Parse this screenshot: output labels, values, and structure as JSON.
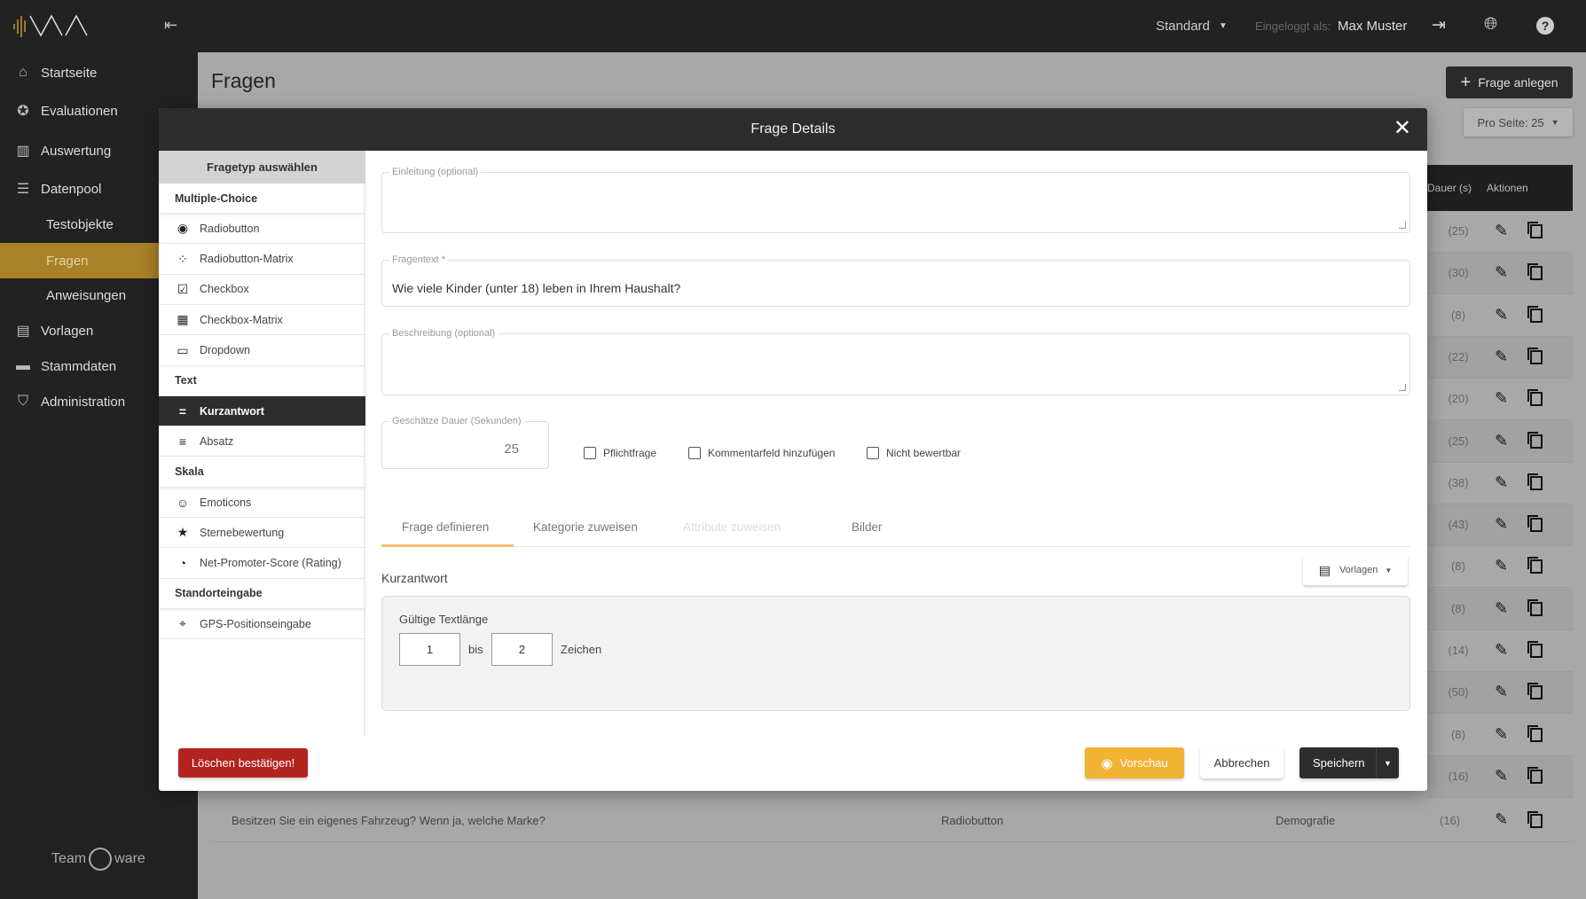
{
  "topbar": {
    "mode_label": "Standard",
    "logged_in_label": "Eingeloggt als:",
    "user_name": "Max Muster",
    "icons": [
      "logout-icon",
      "globe-icon",
      "help-icon"
    ]
  },
  "sidebar": {
    "items": [
      {
        "label": "Startseite",
        "icon": "home-icon"
      },
      {
        "label": "Evaluationen",
        "icon": "star-circle-icon"
      },
      {
        "label": "Auswertung",
        "icon": "bar-chart-icon"
      },
      {
        "label": "Datenpool",
        "icon": "list-icon"
      },
      {
        "label": "Testobjekte",
        "sub": true
      },
      {
        "label": "Fragen",
        "sub": true,
        "active": true
      },
      {
        "label": "Anweisungen",
        "sub": true
      },
      {
        "label": "Vorlagen",
        "icon": "template-icon"
      },
      {
        "label": "Stammdaten",
        "icon": "tray-icon"
      },
      {
        "label": "Administration",
        "icon": "shield-icon"
      }
    ],
    "footer_logo": "Team ware"
  },
  "page": {
    "title": "Fragen",
    "create_button": "Frage anlegen",
    "per_page": "Pro Seite: 25",
    "table": {
      "headers": [
        "Dauer (s)",
        "Aktionen"
      ],
      "durations": [
        "(25)",
        "(30)",
        "(8)",
        "(22)",
        "(20)",
        "(25)",
        "(38)",
        "(43)",
        "(8)",
        "(8)",
        "(14)",
        "(50)",
        "(8)",
        "(16)"
      ],
      "last_row": {
        "question": "Besitzen Sie ein eigenes Fahrzeug? Wenn ja, welche Marke?",
        "type": "Radiobutton",
        "category": "Demografie",
        "duration": "(16)"
      }
    }
  },
  "modal": {
    "title": "Frage Details",
    "type_panel": {
      "header": "Fragetyp auswählen",
      "rows": [
        {
          "label": "Multiple-Choice",
          "category": true
        },
        {
          "label": "Radiobutton",
          "icon": "◉"
        },
        {
          "label": "Radiobutton-Matrix",
          "icon": "⁘"
        },
        {
          "label": "Checkbox",
          "icon": "☑"
        },
        {
          "label": "Checkbox-Matrix",
          "icon": "▦"
        },
        {
          "label": "Dropdown",
          "icon": "▭"
        },
        {
          "label": "Text",
          "category": true
        },
        {
          "label": "Kurzantwort",
          "icon": "=",
          "selected": true
        },
        {
          "label": "Absatz",
          "icon": "≡"
        },
        {
          "label": "Skala",
          "category": true
        },
        {
          "label": "Emoticons",
          "icon": "☺"
        },
        {
          "label": "Sternebewertung",
          "icon": "★"
        },
        {
          "label": "Net-Promoter-Score (Rating)",
          "icon": "◔"
        },
        {
          "label": "Standorteingabe",
          "category": true
        },
        {
          "label": "GPS-Positionseingabe",
          "icon": "⌖"
        }
      ]
    },
    "fields": {
      "intro_label": "Einleitung (optional)",
      "intro_value": "",
      "question_label": "Fragentext *",
      "question_value": "Wie viele Kinder (unter 18) leben in Ihrem Haushalt?",
      "description_label": "Beschreibung (optional)",
      "description_value": "",
      "duration_label": "Geschätze Dauer (Sekunden)",
      "duration_value": "25"
    },
    "checkboxes": [
      {
        "label": "Pflichtfrage",
        "checked": false
      },
      {
        "label": "Kommentarfeld hinzufügen",
        "checked": false
      },
      {
        "label": "Nicht bewertbar",
        "checked": false
      }
    ],
    "tabs": [
      {
        "label": "Frage definieren",
        "active": true
      },
      {
        "label": "Kategorie zuweisen"
      },
      {
        "label": "Attribute zuweisen",
        "disabled": true
      },
      {
        "label": "Bilder"
      }
    ],
    "section_title": "Kurzantwort",
    "templates_button": "Vorlagen",
    "text_length": {
      "label": "Gültige Textlänge",
      "min": "1",
      "between": "bis",
      "max": "2",
      "unit": "Zeichen"
    },
    "footer": {
      "delete": "Löschen bestätigen!",
      "preview": "Vorschau",
      "cancel": "Abbrechen",
      "save": "Speichern"
    }
  },
  "colors": {
    "accent": "#a98128",
    "preview": "#f2b233",
    "danger": "#b3241f",
    "dark": "#2d2d2d"
  }
}
